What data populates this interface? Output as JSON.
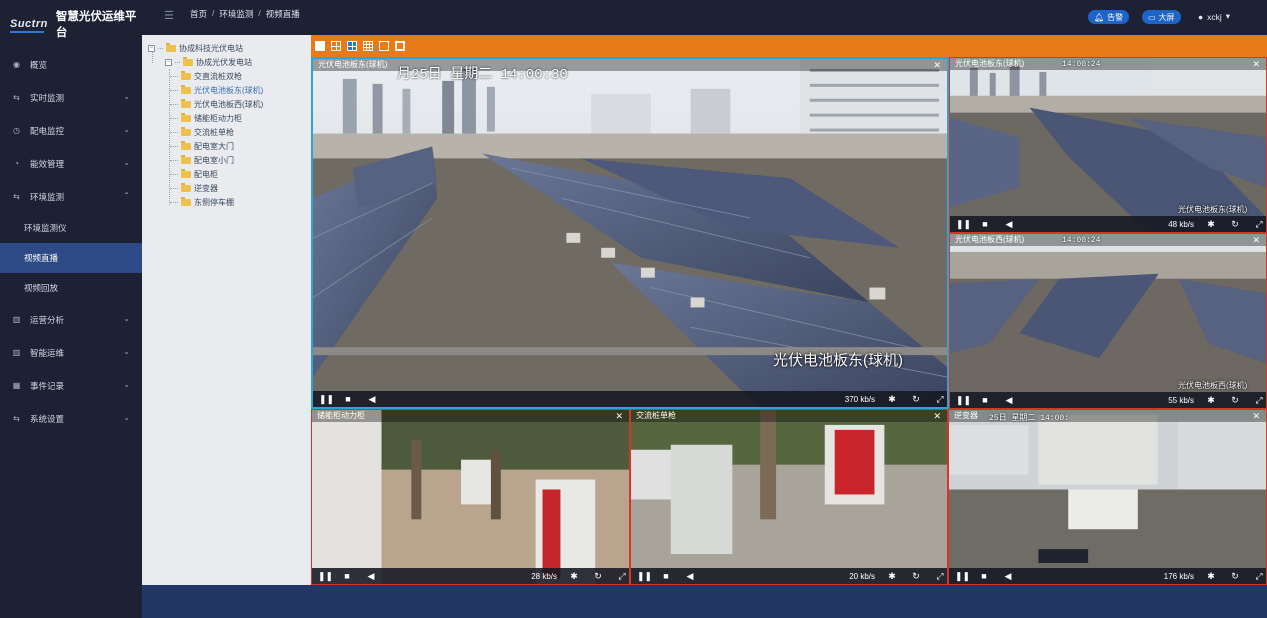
{
  "brand": {
    "logo_text": "Suctrn",
    "app_title": "智慧光伏运维平台"
  },
  "sidebar": {
    "items": [
      {
        "label": "概览",
        "icon": "dashboard-icon",
        "has_chevron": false
      },
      {
        "label": "实时监测",
        "icon": "swap-icon",
        "has_chevron": true
      },
      {
        "label": "配电监控",
        "icon": "clock-icon",
        "has_chevron": true
      },
      {
        "label": "能效管理",
        "icon": "gauge-icon",
        "has_chevron": true
      },
      {
        "label": "环境监测",
        "icon": "swap-icon",
        "has_chevron": true,
        "expanded": true
      },
      {
        "label": "运营分析",
        "icon": "bar-chart-icon",
        "has_chevron": true
      },
      {
        "label": "智能运维",
        "icon": "bar-chart-icon",
        "has_chevron": true
      },
      {
        "label": "事件记录",
        "icon": "calendar-icon",
        "has_chevron": true
      },
      {
        "label": "系统设置",
        "icon": "swap-icon",
        "has_chevron": true
      }
    ],
    "subitems": [
      {
        "label": "环境监测仪",
        "active": false
      },
      {
        "label": "视频直播",
        "active": true
      },
      {
        "label": "视频回放",
        "active": false
      }
    ]
  },
  "header": {
    "breadcrumb": [
      "首页",
      "环境监测",
      "视频直播"
    ],
    "alarm_label": "告警",
    "bigscreen_label": "大屏",
    "user": "xckj"
  },
  "tree": {
    "root": "协成科技光伏电站",
    "station": "协成光伏发电站",
    "cameras": [
      "交直流桩双枪",
      "光伏电池板东(球机)",
      "光伏电池板西(球机)",
      "储能柜动力柜",
      "交流桩单枪",
      "配电室大门",
      "配电室小门",
      "配电柜",
      "逆变器",
      "东侧停车棚"
    ],
    "selected": "光伏电池板东(球机)"
  },
  "toolbar": {
    "layouts": [
      "1x1",
      "2x2",
      "1+5",
      "3x3",
      "4x4"
    ],
    "selected_layout": "1+5",
    "fullscreen_icon": "fullscreen-icon"
  },
  "videos": [
    {
      "title": "光伏电池板东(球机)",
      "rate": "370 kb/s",
      "osd": "月25日 星期二 14:00:30",
      "label": "光伏电池板东(球机)"
    },
    {
      "title": "光伏电池板东(球机)",
      "rate": "48 kb/s",
      "osd": "14:00:24",
      "label": "光伏电池板东(球机)"
    },
    {
      "title": "光伏电池板西(球机)",
      "rate": "55 kb/s",
      "osd": "14:00:24",
      "label": "光伏电池板西(球机)"
    },
    {
      "title": "储能柜动力柜",
      "rate": "28 kb/s"
    },
    {
      "title": "交流桩单枪",
      "rate": "20 kb/s"
    },
    {
      "title": "逆变器",
      "rate": "176 kb/s",
      "osd": "25日 星期二 14:00:"
    }
  ],
  "colors": {
    "toolbar": "#e97a18",
    "active_border": "#2fa4d4",
    "inactive_border": "#d9332b",
    "menu_active": "#2d4a87",
    "header_button": "#1e63c8"
  }
}
